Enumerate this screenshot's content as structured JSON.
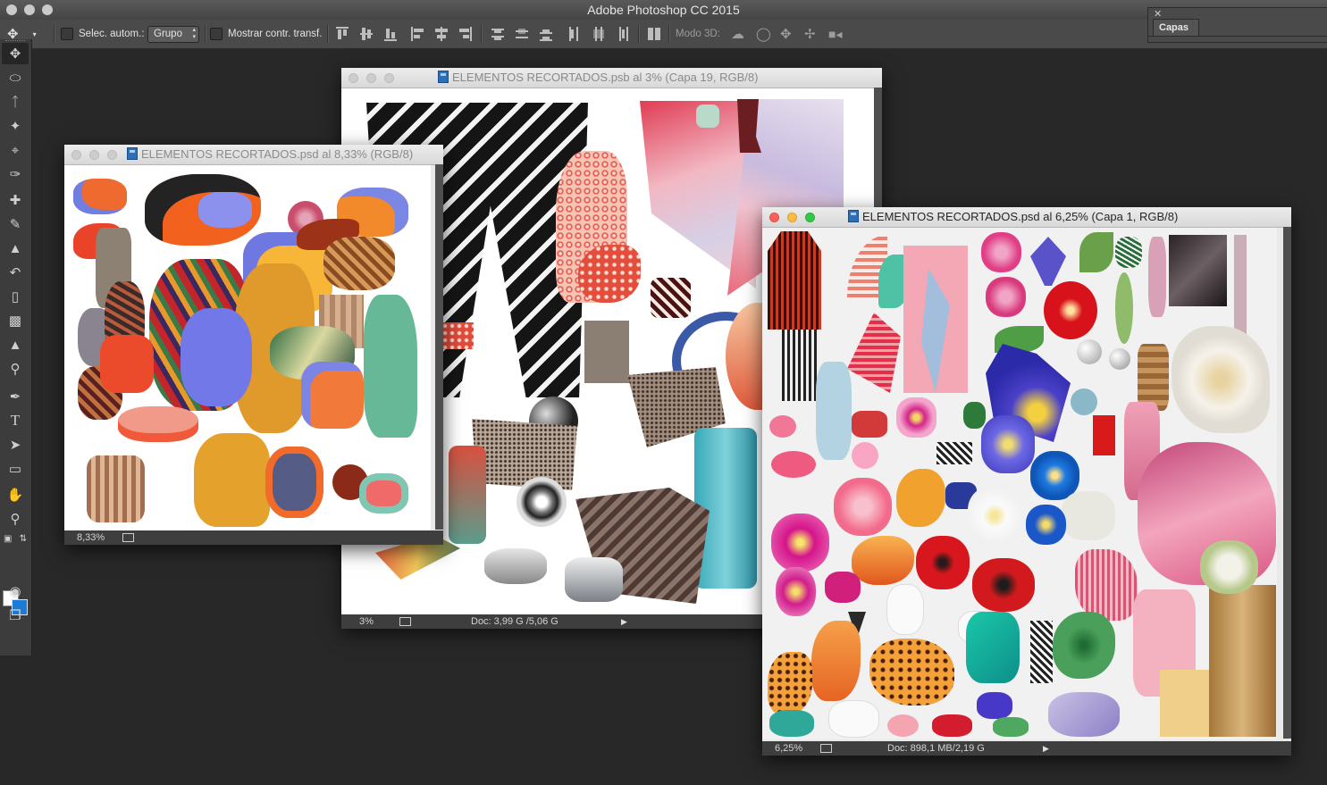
{
  "app": {
    "title": "Adobe Photoshop CC 2015"
  },
  "options_bar": {
    "auto_select_label": "Selec. autom.:",
    "auto_select_value": "Grupo",
    "show_transform_label": "Mostrar contr. transf.",
    "mode_3d_label": "Modo 3D:"
  },
  "layers_panel": {
    "tab_label": "Capas"
  },
  "documents": [
    {
      "title": "ELEMENTOS RECORTADOS.psb al 3% (Capa 19, RGB/8)",
      "zoom": "3%",
      "doc_info": "Doc: 3,99 G /5,06 G"
    },
    {
      "title": "ELEMENTOS RECORTADOS.psd al 8,33% (RGB/8)",
      "zoom": "8,33%"
    },
    {
      "title": "ELEMENTOS RECORTADOS.psd al 6,25% (Capa 1, RGB/8)",
      "zoom": "6,25%",
      "doc_info": "Doc: 898,1 MB/2,19 G"
    }
  ],
  "colors": {
    "accent": "#1b7bd6",
    "window_close": "#fc605b",
    "window_minimize": "#fdbc40",
    "window_zoom": "#34c84a"
  },
  "icons": [
    "move-icon",
    "marquee-icon",
    "lasso-icon",
    "magic-wand-icon",
    "crop-icon",
    "eyedropper-icon",
    "healing-brush-icon",
    "brush-icon",
    "stamp-icon",
    "history-brush-icon",
    "eraser-icon",
    "gradient-icon",
    "blur-icon",
    "dodge-icon",
    "pen-icon",
    "type-icon",
    "path-selection-icon",
    "rectangle-icon",
    "hand-icon",
    "zoom-icon",
    "quick-mask-icon",
    "screen-mode-icon"
  ]
}
